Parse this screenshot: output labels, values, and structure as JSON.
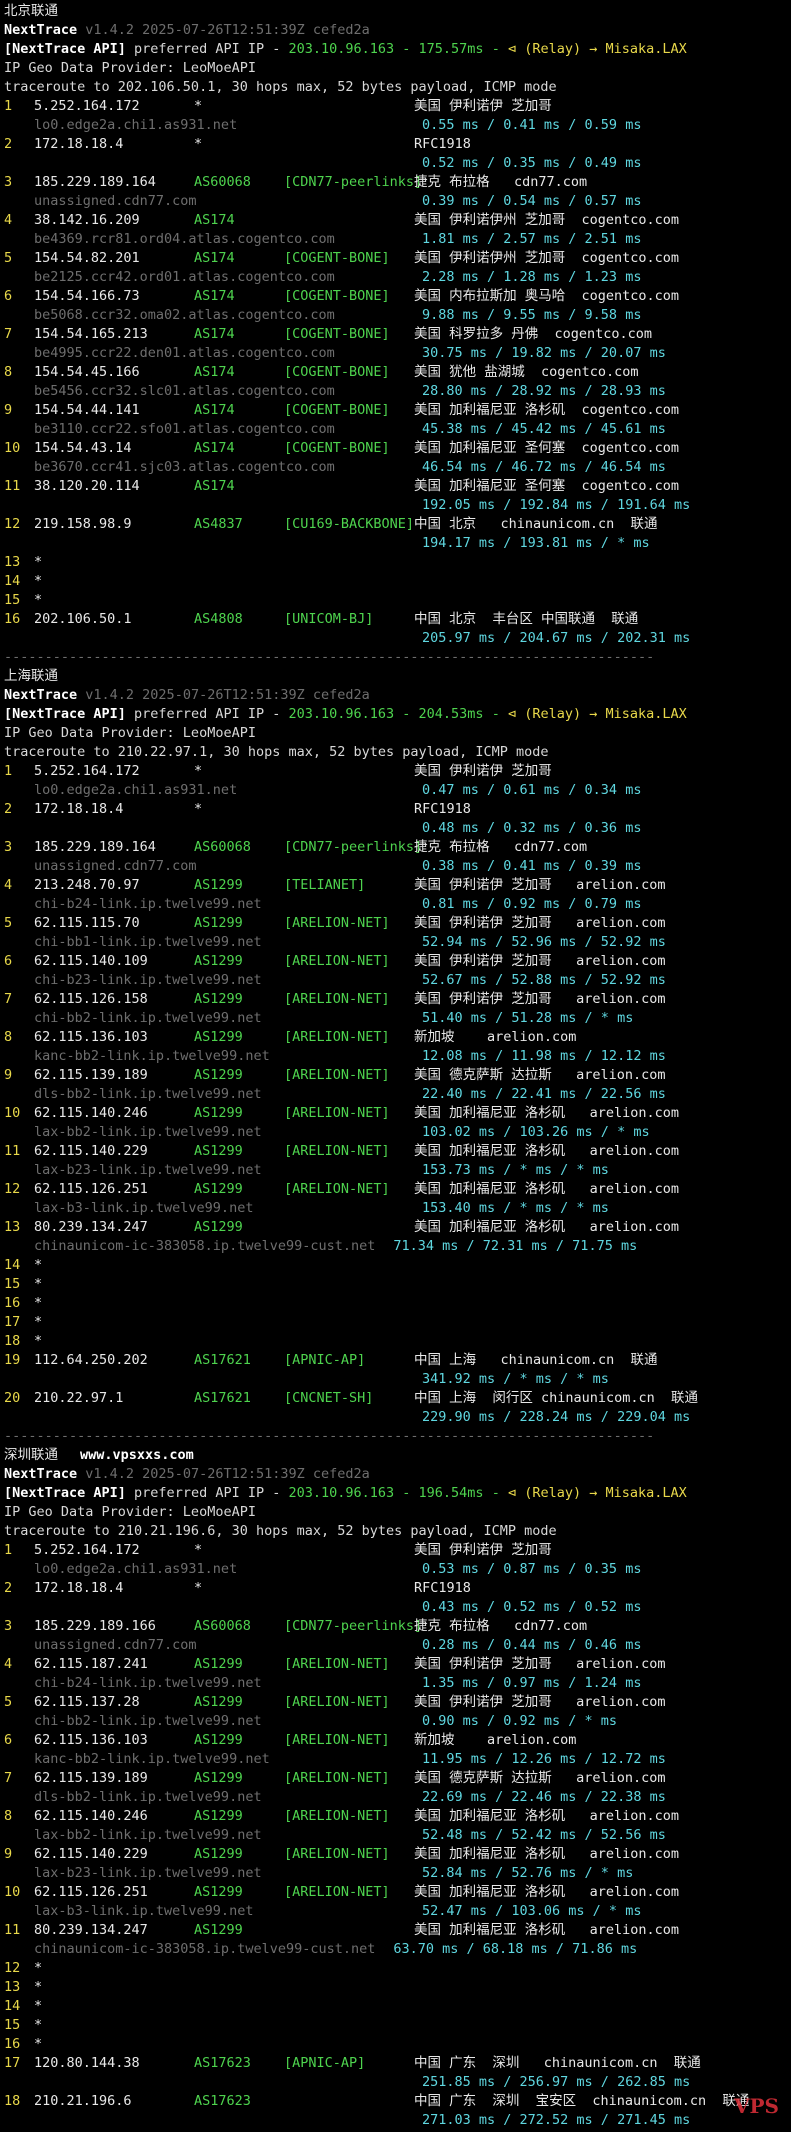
{
  "sections": [
    {
      "title": "北京联通",
      "extra": "",
      "header": {
        "app": "NextTrace",
        "version": "v1.4.2 2025-07-26T12:51:39Z cefed2a",
        "api_prefix": "[NextTrace API]",
        "api_text": "preferred API IP - ",
        "api_ip": "203.10.96.163",
        "api_latency": " - 175.57ms - ",
        "relay": "⊲ (Relay) → Misaka.LAX",
        "geo_provider": "IP Geo Data Provider: LeoMoeAPI",
        "traceroute": "traceroute to 202.106.50.1, 30 hops max, 52 bytes payload, ICMP mode"
      },
      "hops": [
        {
          "n": "1",
          "ip": "5.252.164.172",
          "asn": "*",
          "tag": "",
          "geo": "美国 伊利诺伊 芝加哥",
          "host": "lo0.edge2a.chi1.as931.net",
          "rtt": "0.55 ms / 0.41 ms / 0.59 ms"
        },
        {
          "n": "2",
          "ip": "172.18.18.4",
          "asn": "*",
          "tag": "",
          "geo": "RFC1918",
          "host": "",
          "rtt": "0.52 ms / 0.35 ms / 0.49 ms"
        },
        {
          "n": "3",
          "ip": "185.229.189.164",
          "asn": "AS60068",
          "tag": "[CDN77-peerlinks]",
          "geo": "捷克 布拉格   cdn77.com",
          "host": "unassigned.cdn77.com",
          "rtt": "0.39 ms / 0.54 ms / 0.57 ms"
        },
        {
          "n": "4",
          "ip": "38.142.16.209",
          "asn": "AS174",
          "tag": "",
          "geo": "美国 伊利诺伊州 芝加哥  cogentco.com",
          "host": "be4369.rcr81.ord04.atlas.cogentco.com",
          "rtt": "1.81 ms / 2.57 ms / 2.51 ms"
        },
        {
          "n": "5",
          "ip": "154.54.82.201",
          "asn": "AS174",
          "tag": "[COGENT-BONE]",
          "geo": "美国 伊利诺伊州 芝加哥  cogentco.com",
          "host": "be2125.ccr42.ord01.atlas.cogentco.com",
          "rtt": "2.28 ms / 1.28 ms / 1.23 ms"
        },
        {
          "n": "6",
          "ip": "154.54.166.73",
          "asn": "AS174",
          "tag": "[COGENT-BONE]",
          "geo": "美国 内布拉斯加 奥马哈  cogentco.com",
          "host": "be5068.ccr32.oma02.atlas.cogentco.com",
          "rtt": "9.88 ms / 9.55 ms / 9.58 ms"
        },
        {
          "n": "7",
          "ip": "154.54.165.213",
          "asn": "AS174",
          "tag": "[COGENT-BONE]",
          "geo": "美国 科罗拉多 丹佛  cogentco.com",
          "host": "be4995.ccr22.den01.atlas.cogentco.com",
          "rtt": "30.75 ms / 19.82 ms / 20.07 ms"
        },
        {
          "n": "8",
          "ip": "154.54.45.166",
          "asn": "AS174",
          "tag": "[COGENT-BONE]",
          "geo": "美国 犹他 盐湖城  cogentco.com",
          "host": "be5456.ccr32.slc01.atlas.cogentco.com",
          "rtt": "28.80 ms / 28.92 ms / 28.93 ms"
        },
        {
          "n": "9",
          "ip": "154.54.44.141",
          "asn": "AS174",
          "tag": "[COGENT-BONE]",
          "geo": "美国 加利福尼亚 洛杉矶  cogentco.com",
          "host": "be3110.ccr22.sfo01.atlas.cogentco.com",
          "rtt": "45.38 ms / 45.42 ms / 45.61 ms"
        },
        {
          "n": "10",
          "ip": "154.54.43.14",
          "asn": "AS174",
          "tag": "[COGENT-BONE]",
          "geo": "美国 加利福尼亚 圣何塞  cogentco.com",
          "host": "be3670.ccr41.sjc03.atlas.cogentco.com",
          "rtt": "46.54 ms / 46.72 ms / 46.54 ms"
        },
        {
          "n": "11",
          "ip": "38.120.20.114",
          "asn": "AS174",
          "tag": "",
          "geo": "美国 加利福尼亚 圣何塞  cogentco.com",
          "host": "",
          "rtt": "192.05 ms / 192.84 ms / 191.64 ms"
        },
        {
          "n": "12",
          "ip": "219.158.98.9",
          "asn": "AS4837",
          "tag": "[CU169-BACKBONE]",
          "geo": "中国 北京   chinaunicom.cn  联通",
          "host": "",
          "rtt": "194.17 ms / 193.81 ms / * ms"
        },
        {
          "n": "13",
          "ip": "*",
          "asn": "",
          "tag": "",
          "geo": "",
          "host": "",
          "rtt": ""
        },
        {
          "n": "14",
          "ip": "*",
          "asn": "",
          "tag": "",
          "geo": "",
          "host": "",
          "rtt": ""
        },
        {
          "n": "15",
          "ip": "*",
          "asn": "",
          "tag": "",
          "geo": "",
          "host": "",
          "rtt": ""
        },
        {
          "n": "16",
          "ip": "202.106.50.1",
          "asn": "AS4808",
          "tag": "[UNICOM-BJ]",
          "geo": "中国 北京  丰台区 中国联通  联通",
          "host": "",
          "rtt": "205.97 ms / 204.67 ms / 202.31 ms"
        }
      ]
    },
    {
      "title": "上海联通",
      "extra": "",
      "header": {
        "app": "NextTrace",
        "version": "v1.4.2 2025-07-26T12:51:39Z cefed2a",
        "api_prefix": "[NextTrace API]",
        "api_text": "preferred API IP - ",
        "api_ip": "203.10.96.163",
        "api_latency": " - 204.53ms - ",
        "relay": "⊲ (Relay) → Misaka.LAX",
        "geo_provider": "IP Geo Data Provider: LeoMoeAPI",
        "traceroute": "traceroute to 210.22.97.1, 30 hops max, 52 bytes payload, ICMP mode"
      },
      "hops": [
        {
          "n": "1",
          "ip": "5.252.164.172",
          "asn": "*",
          "tag": "",
          "geo": "美国 伊利诺伊 芝加哥",
          "host": "lo0.edge2a.chi1.as931.net",
          "rtt": "0.47 ms / 0.61 ms / 0.34 ms"
        },
        {
          "n": "2",
          "ip": "172.18.18.4",
          "asn": "*",
          "tag": "",
          "geo": "RFC1918",
          "host": "",
          "rtt": "0.48 ms / 0.32 ms / 0.36 ms"
        },
        {
          "n": "3",
          "ip": "185.229.189.164",
          "asn": "AS60068",
          "tag": "[CDN77-peerlinks]",
          "geo": "捷克 布拉格   cdn77.com",
          "host": "unassigned.cdn77.com",
          "rtt": "0.38 ms / 0.41 ms / 0.39 ms"
        },
        {
          "n": "4",
          "ip": "213.248.70.97",
          "asn": "AS1299",
          "tag": "[TELIANET]",
          "geo": "美国 伊利诺伊 芝加哥   arelion.com",
          "host": "chi-b24-link.ip.twelve99.net",
          "rtt": "0.81 ms / 0.92 ms / 0.79 ms"
        },
        {
          "n": "5",
          "ip": "62.115.115.70",
          "asn": "AS1299",
          "tag": "[ARELION-NET]",
          "geo": "美国 伊利诺伊 芝加哥   arelion.com",
          "host": "chi-bb1-link.ip.twelve99.net",
          "rtt": "52.94 ms / 52.96 ms / 52.92 ms"
        },
        {
          "n": "6",
          "ip": "62.115.140.109",
          "asn": "AS1299",
          "tag": "[ARELION-NET]",
          "geo": "美国 伊利诺伊 芝加哥   arelion.com",
          "host": "chi-b23-link.ip.twelve99.net",
          "rtt": "52.67 ms / 52.88 ms / 52.92 ms"
        },
        {
          "n": "7",
          "ip": "62.115.126.158",
          "asn": "AS1299",
          "tag": "[ARELION-NET]",
          "geo": "美国 伊利诺伊 芝加哥   arelion.com",
          "host": "chi-bb2-link.ip.twelve99.net",
          "rtt": "51.40 ms / 51.28 ms / * ms"
        },
        {
          "n": "8",
          "ip": "62.115.136.103",
          "asn": "AS1299",
          "tag": "[ARELION-NET]",
          "geo": "新加坡    arelion.com",
          "host": "kanc-bb2-link.ip.twelve99.net",
          "rtt": "12.08 ms / 11.98 ms / 12.12 ms"
        },
        {
          "n": "9",
          "ip": "62.115.139.189",
          "asn": "AS1299",
          "tag": "[ARELION-NET]",
          "geo": "美国 德克萨斯 达拉斯   arelion.com",
          "host": "dls-bb2-link.ip.twelve99.net",
          "rtt": "22.40 ms / 22.41 ms / 22.56 ms"
        },
        {
          "n": "10",
          "ip": "62.115.140.246",
          "asn": "AS1299",
          "tag": "[ARELION-NET]",
          "geo": "美国 加利福尼亚 洛杉矶   arelion.com",
          "host": "lax-bb2-link.ip.twelve99.net",
          "rtt": "103.02 ms / 103.26 ms / * ms"
        },
        {
          "n": "11",
          "ip": "62.115.140.229",
          "asn": "AS1299",
          "tag": "[ARELION-NET]",
          "geo": "美国 加利福尼亚 洛杉矶   arelion.com",
          "host": "lax-b23-link.ip.twelve99.net",
          "rtt": "153.73 ms / * ms / * ms"
        },
        {
          "n": "12",
          "ip": "62.115.126.251",
          "asn": "AS1299",
          "tag": "[ARELION-NET]",
          "geo": "美国 加利福尼亚 洛杉矶   arelion.com",
          "host": "lax-b3-link.ip.twelve99.net",
          "rtt": "153.40 ms / * ms / * ms"
        },
        {
          "n": "13",
          "ip": "80.239.134.247",
          "asn": "AS1299",
          "tag": "",
          "geo": "美国 加利福尼亚 洛杉矶   arelion.com",
          "host": "chinaunicom-ic-383058.ip.twelve99-cust.net",
          "rtt": "71.34 ms / 72.31 ms / 71.75 ms",
          "rtt_inline": true
        },
        {
          "n": "14",
          "ip": "*",
          "asn": "",
          "tag": "",
          "geo": "",
          "host": "",
          "rtt": ""
        },
        {
          "n": "15",
          "ip": "*",
          "asn": "",
          "tag": "",
          "geo": "",
          "host": "",
          "rtt": ""
        },
        {
          "n": "16",
          "ip": "*",
          "asn": "",
          "tag": "",
          "geo": "",
          "host": "",
          "rtt": ""
        },
        {
          "n": "17",
          "ip": "*",
          "asn": "",
          "tag": "",
          "geo": "",
          "host": "",
          "rtt": ""
        },
        {
          "n": "18",
          "ip": "*",
          "asn": "",
          "tag": "",
          "geo": "",
          "host": "",
          "rtt": ""
        },
        {
          "n": "19",
          "ip": "112.64.250.202",
          "asn": "AS17621",
          "tag": "[APNIC-AP]",
          "geo": "中国 上海   chinaunicom.cn  联通",
          "host": "",
          "rtt": "341.92 ms / * ms / * ms"
        },
        {
          "n": "20",
          "ip": "210.22.97.1",
          "asn": "AS17621",
          "tag": "[CNCNET-SH]",
          "geo": "中国 上海  闵行区 chinaunicom.cn  联通",
          "host": "",
          "rtt": "229.90 ms / 228.24 ms / 229.04 ms"
        }
      ]
    },
    {
      "title": "深圳联通",
      "extra": "www.vpsxxs.com",
      "header": {
        "app": "NextTrace",
        "version": "v1.4.2 2025-07-26T12:51:39Z cefed2a",
        "api_prefix": "[NextTrace API]",
        "api_text": "preferred API IP - ",
        "api_ip": "203.10.96.163",
        "api_latency": " - 196.54ms - ",
        "relay": "⊲ (Relay) → Misaka.LAX",
        "geo_provider": "IP Geo Data Provider: LeoMoeAPI",
        "traceroute": "traceroute to 210.21.196.6, 30 hops max, 52 bytes payload, ICMP mode"
      },
      "hops": [
        {
          "n": "1",
          "ip": "5.252.164.172",
          "asn": "*",
          "tag": "",
          "geo": "美国 伊利诺伊 芝加哥",
          "host": "lo0.edge2a.chi1.as931.net",
          "rtt": "0.53 ms / 0.87 ms / 0.35 ms"
        },
        {
          "n": "2",
          "ip": "172.18.18.4",
          "asn": "*",
          "tag": "",
          "geo": "RFC1918",
          "host": "",
          "rtt": "0.43 ms / 0.52 ms / 0.52 ms"
        },
        {
          "n": "3",
          "ip": "185.229.189.166",
          "asn": "AS60068",
          "tag": "[CDN77-peerlinks]",
          "geo": "捷克 布拉格   cdn77.com",
          "host": "unassigned.cdn77.com",
          "rtt": "0.28 ms / 0.44 ms / 0.46 ms"
        },
        {
          "n": "4",
          "ip": "62.115.187.241",
          "asn": "AS1299",
          "tag": "[ARELION-NET]",
          "geo": "美国 伊利诺伊 芝加哥   arelion.com",
          "host": "chi-b24-link.ip.twelve99.net",
          "rtt": "1.35 ms / 0.97 ms / 1.24 ms"
        },
        {
          "n": "5",
          "ip": "62.115.137.28",
          "asn": "AS1299",
          "tag": "[ARELION-NET]",
          "geo": "美国 伊利诺伊 芝加哥   arelion.com",
          "host": "chi-bb2-link.ip.twelve99.net",
          "rtt": "0.90 ms / 0.92 ms / * ms"
        },
        {
          "n": "6",
          "ip": "62.115.136.103",
          "asn": "AS1299",
          "tag": "[ARELION-NET]",
          "geo": "新加坡    arelion.com",
          "host": "kanc-bb2-link.ip.twelve99.net",
          "rtt": "11.95 ms / 12.26 ms / 12.72 ms"
        },
        {
          "n": "7",
          "ip": "62.115.139.189",
          "asn": "AS1299",
          "tag": "[ARELION-NET]",
          "geo": "美国 德克萨斯 达拉斯   arelion.com",
          "host": "dls-bb2-link.ip.twelve99.net",
          "rtt": "22.69 ms / 22.46 ms / 22.38 ms"
        },
        {
          "n": "8",
          "ip": "62.115.140.246",
          "asn": "AS1299",
          "tag": "[ARELION-NET]",
          "geo": "美国 加利福尼亚 洛杉矶   arelion.com",
          "host": "lax-bb2-link.ip.twelve99.net",
          "rtt": "52.48 ms / 52.42 ms / 52.56 ms"
        },
        {
          "n": "9",
          "ip": "62.115.140.229",
          "asn": "AS1299",
          "tag": "[ARELION-NET]",
          "geo": "美国 加利福尼亚 洛杉矶   arelion.com",
          "host": "lax-b23-link.ip.twelve99.net",
          "rtt": "52.84 ms / 52.76 ms / * ms"
        },
        {
          "n": "10",
          "ip": "62.115.126.251",
          "asn": "AS1299",
          "tag": "[ARELION-NET]",
          "geo": "美国 加利福尼亚 洛杉矶   arelion.com",
          "host": "lax-b3-link.ip.twelve99.net",
          "rtt": "52.47 ms / 103.06 ms / * ms"
        },
        {
          "n": "11",
          "ip": "80.239.134.247",
          "asn": "AS1299",
          "tag": "",
          "geo": "美国 加利福尼亚 洛杉矶   arelion.com",
          "host": "chinaunicom-ic-383058.ip.twelve99-cust.net",
          "rtt": "63.70 ms / 68.18 ms / 71.86 ms",
          "rtt_inline": true
        },
        {
          "n": "12",
          "ip": "*",
          "asn": "",
          "tag": "",
          "geo": "",
          "host": "",
          "rtt": ""
        },
        {
          "n": "13",
          "ip": "*",
          "asn": "",
          "tag": "",
          "geo": "",
          "host": "",
          "rtt": ""
        },
        {
          "n": "14",
          "ip": "*",
          "asn": "",
          "tag": "",
          "geo": "",
          "host": "",
          "rtt": ""
        },
        {
          "n": "15",
          "ip": "*",
          "asn": "",
          "tag": "",
          "geo": "",
          "host": "",
          "rtt": ""
        },
        {
          "n": "16",
          "ip": "*",
          "asn": "",
          "tag": "",
          "geo": "",
          "host": "",
          "rtt": ""
        },
        {
          "n": "17",
          "ip": "120.80.144.38",
          "asn": "AS17623",
          "tag": "[APNIC-AP]",
          "geo": "中国 广东  深圳   chinaunicom.cn  联通",
          "host": "",
          "rtt": "251.85 ms / 256.97 ms / 262.85 ms"
        },
        {
          "n": "18",
          "ip": "210.21.196.6",
          "asn": "AS17623",
          "tag": "",
          "geo": "中国 广东  深圳  宝安区  chinaunicom.cn  联通",
          "host": "",
          "rtt": "271.03 ms / 272.52 ms / 271.45 ms"
        }
      ]
    }
  ],
  "separator": "--------------------------------------------------------------------------------",
  "watermark": "VPS"
}
